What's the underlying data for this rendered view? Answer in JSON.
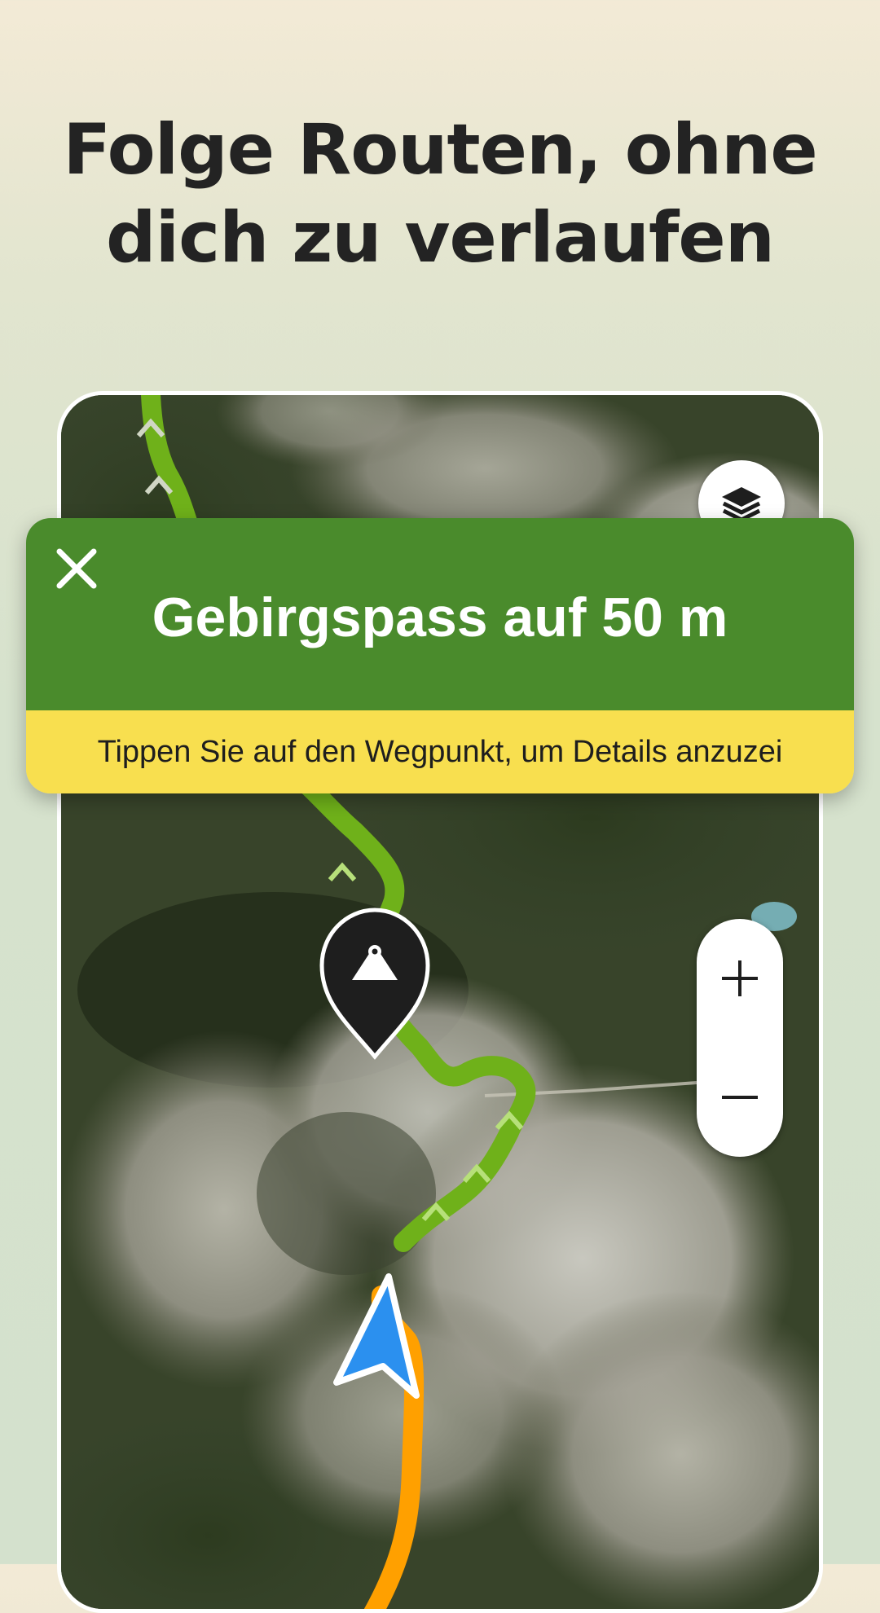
{
  "headline": {
    "line1": "Folge Routen, ohne",
    "line2": "dich zu verlaufen"
  },
  "map": {
    "icons": {
      "layers": "layers-icon",
      "waypoint": "mountain-pass-pin-icon",
      "position": "navigation-arrow-icon",
      "zoom_in": "plus-icon",
      "zoom_out": "minus-icon"
    }
  },
  "nav_card": {
    "instruction": "Gebirgspass auf 50 m",
    "hint": "Tippen Sie auf den Wegpunkt, um Details anzuzei",
    "close_icon": "close-icon"
  },
  "colors": {
    "route_planned": "#6fb11a",
    "route_planned_dash": "#b7e07a",
    "route_traveled": "#ffa000",
    "position_arrow": "#2b90ef",
    "card_green": "#4a8b2c",
    "card_yellow": "#f8df4f",
    "headline_text": "#232323"
  }
}
